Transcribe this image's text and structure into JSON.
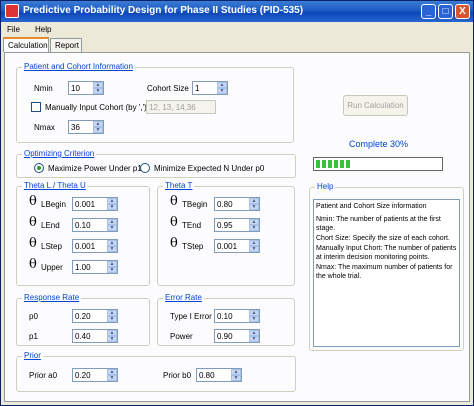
{
  "window": {
    "title": "Predictive Probability Design for Phase II Studies (PID-535)",
    "minimize": "_",
    "maximize": "□",
    "close": "X"
  },
  "menu": [
    "File",
    "Help"
  ],
  "tabs": [
    "Calculation",
    "Report"
  ],
  "patient": {
    "group_label": "Patient and Cohort Information",
    "nmin_label": "Nmin",
    "nmin_value": "10",
    "cohort_label": "Cohort Size",
    "cohort_value": "1",
    "manual_label": "Manually Input Cohort (by ',')",
    "manual_value": "12, 13, 14,36",
    "nmax_label": "Nmax",
    "nmax_value": "36"
  },
  "run_button": "Run Calculation",
  "status": "Complete 30%",
  "progress_fraction": 0.3,
  "optimizing": {
    "group_label": "Optimizing Criterion",
    "option1": "Maximize Power Under p1",
    "option2": "Minimize Expected N Under p0"
  },
  "theta_lu": {
    "group_label": "Theta L / Theta U",
    "rows": [
      {
        "sym": "θ",
        "sub": "LBegin",
        "value": "0.001"
      },
      {
        "sym": "θ",
        "sub": "LEnd",
        "value": "0.10"
      },
      {
        "sym": "θ",
        "sub": "LStep",
        "value": "0.001"
      },
      {
        "sym": "θ",
        "sub": "Upper",
        "value": "1.00"
      }
    ]
  },
  "theta_t": {
    "group_label": "Theta T",
    "rows": [
      {
        "sym": "θ",
        "sub": "TBegin",
        "value": "0.80"
      },
      {
        "sym": "θ",
        "sub": "TEnd",
        "value": "0.95"
      },
      {
        "sym": "θ",
        "sub": "TStep",
        "value": "0.001"
      }
    ]
  },
  "response": {
    "group_label": "Response Rate",
    "p0_label": "p0",
    "p0_value": "0.20",
    "p1_label": "p1",
    "p1_value": "0.40"
  },
  "error": {
    "group_label": "Error Rate",
    "t1_label": "Type I Error",
    "t1_value": "0.10",
    "power_label": "Power",
    "power_value": "0.90"
  },
  "prior": {
    "group_label": "Prior",
    "a0_label": "Prior a0",
    "a0_value": "0.20",
    "b0_label": "Prior b0",
    "b0_value": "0.80"
  },
  "help": {
    "group_label": "Help",
    "lines": [
      "Patient and Cohort Size information",
      "Nmin: The number of patients at the first stage.",
      "Chort Size: Specify the size of each cohort.",
      "Manually Input Chort: The number of patients at interim decision monitoring points.",
      "Nmax: The maximum number of patients for the whole trial."
    ]
  }
}
